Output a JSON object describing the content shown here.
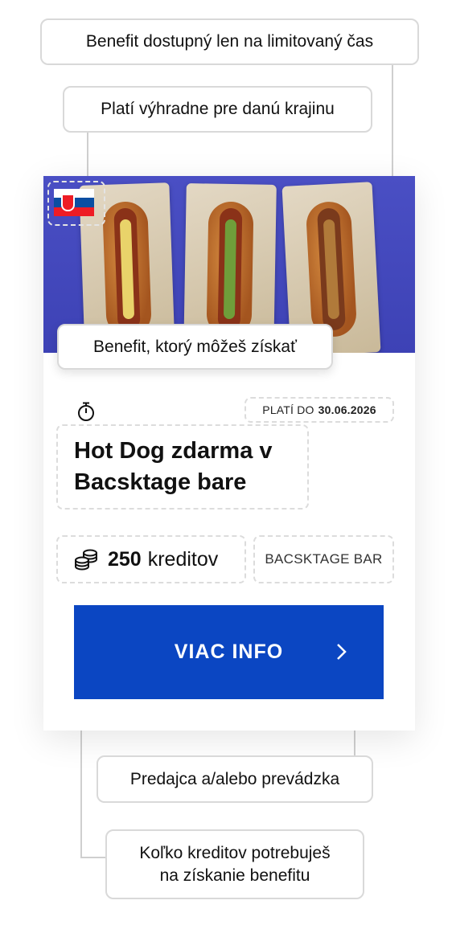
{
  "callouts": {
    "limited_time": "Benefit dostupný len na limitovaný čas",
    "country_only": "Platí výhradne pre danú krajinu",
    "benefit": "Benefit, ktorý môžeš získať",
    "merchant": "Predajca a/alebo prevádzka",
    "credits_line1": "Koľko kreditov potrebuješ",
    "credits_line2": "na získanie benefitu"
  },
  "card": {
    "flag": "slovakia-flag",
    "valid_label": "PLATÍ DO",
    "valid_date": "30.06.2026",
    "timer_icon": "stopwatch-icon",
    "title": "Hot Dog zdarma v Bacsktage bare",
    "credits_value": "250",
    "credits_unit": "kreditov",
    "coins_icon": "coins-icon",
    "merchant": "BACSKTAGE BAR",
    "button_label": "VIAC INFO",
    "button_icon": "chevron-right-icon"
  },
  "colors": {
    "accent": "#0b46c2",
    "hero_bg": "#4a4fc4",
    "connector": "#cfcfcf"
  }
}
